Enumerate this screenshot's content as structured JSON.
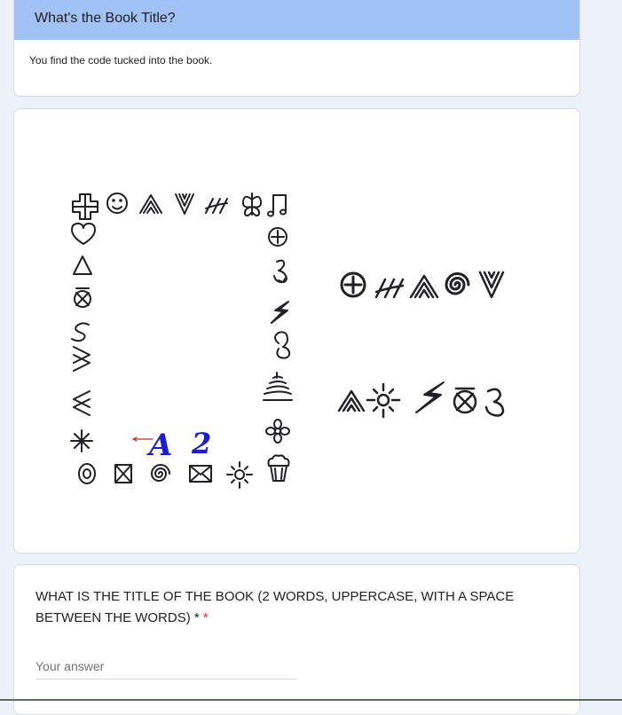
{
  "section": {
    "title": "What's the Book Title?",
    "description": "You find the code tucked into the book."
  },
  "puzzle": {
    "handwritten_a": "A",
    "handwritten_2": "2"
  },
  "question": {
    "text": "WHAT IS THE TITLE OF THE BOOK (2 WORDS, UPPERCASE, WITH A SPACE BETWEEN THE WORDS) *",
    "required_marker": "*",
    "answer_placeholder": "Your answer",
    "answer_value": ""
  },
  "colors": {
    "header_bg": "#a1c2f5",
    "page_bg": "#edf2fa",
    "required": "#d93025",
    "handwriting": "#1a1adb",
    "arrow": "#c62828"
  }
}
